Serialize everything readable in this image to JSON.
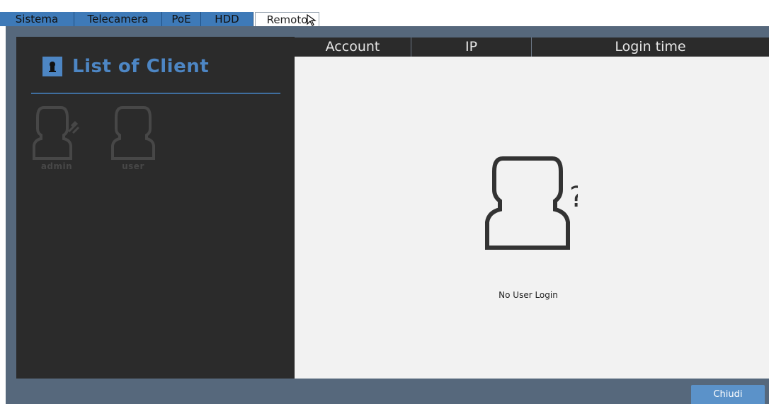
{
  "tabs": [
    {
      "label": "Sistema"
    },
    {
      "label": "Telecamera"
    },
    {
      "label": "PoE"
    },
    {
      "label": "HDD"
    },
    {
      "label": "Remoto",
      "active": true
    }
  ],
  "left_panel": {
    "title": "List of Client",
    "clients": [
      {
        "label": "admin"
      },
      {
        "label": "user"
      }
    ]
  },
  "table": {
    "columns": [
      "Account",
      "IP",
      "Login time"
    ],
    "rows": [],
    "empty_message": "No User Login"
  },
  "footer": {
    "close_label": "Chiudi"
  },
  "colors": {
    "accent": "#4d86c4",
    "tab_bg": "#3e7ab8",
    "frame_bg": "#56687c",
    "panel_bg": "#2b2b2b"
  }
}
